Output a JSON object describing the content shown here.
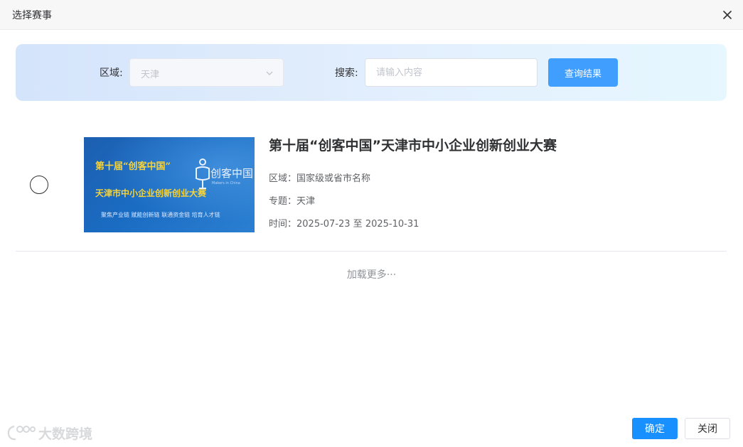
{
  "dialog": {
    "title": "选择赛事",
    "close_icon": "close-icon"
  },
  "filters": {
    "region_label": "区域:",
    "region_value": "天津",
    "region_icon": "chevron-down-icon",
    "search_label": "搜索:",
    "search_placeholder": "请输入内容",
    "search_value": "",
    "query_button": "查询结果",
    "accent_color": "#409eff"
  },
  "events": [
    {
      "selected": false,
      "title": "第十届“创客中国”天津市中小企业创新创业大赛",
      "region": "区域：国家级或省市名称",
      "topic": "专题：天津",
      "time": "时间：2025-07-23 至 2025-10-31",
      "image": {
        "line1": "第十届“创客中国”",
        "line2": "天津市中小企业创新创业大赛",
        "line3": "聚焦产业链 赋能创新链 联通资金链 培育人才链",
        "logo_text": "创客中国",
        "logo_sub": "Makers in China"
      }
    }
  ],
  "load_more": "加载更多···",
  "watermark": "大数跨境",
  "footer": {
    "confirm": "确定",
    "close": "关闭",
    "confirm_color": "#1890ff"
  }
}
